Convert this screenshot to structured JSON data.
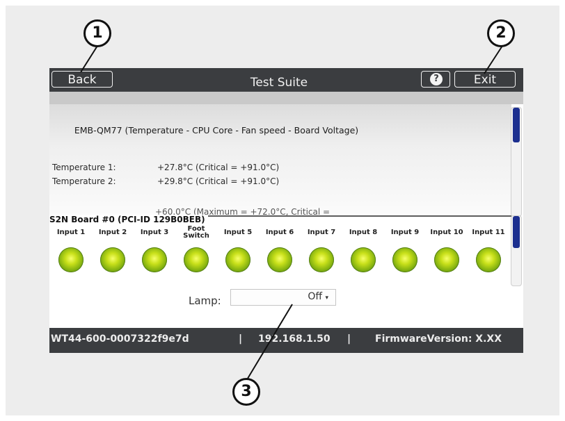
{
  "header": {
    "back_label": "Back",
    "title": "Test Suite",
    "help_label": "?",
    "exit_label": "Exit"
  },
  "sensors": {
    "title": "EMB-QM77 (Temperature - CPU Core - Fan speed - Board Voltage)",
    "rows": [
      {
        "label": "Temperature 1:",
        "value": "+27.8°C (Critical = +91.0°C)"
      },
      {
        "label": "Temperature 2:",
        "value": "+29.8°C (Critical = +91.0°C)"
      }
    ],
    "partial_line": "+60.0°C (Maximum = +72.0°C, Critical ="
  },
  "board": {
    "title": "S2N Board #0 (PCI-ID 129B0BEB)",
    "inputs": [
      {
        "label": "Input 1",
        "state": "on"
      },
      {
        "label": "Input 2",
        "state": "on"
      },
      {
        "label": "Input 3",
        "state": "on"
      },
      {
        "label": "Foot Switch",
        "state": "on"
      },
      {
        "label": "Input 5",
        "state": "on"
      },
      {
        "label": "Input 6",
        "state": "on"
      },
      {
        "label": "Input 7",
        "state": "on"
      },
      {
        "label": "Input 8",
        "state": "on"
      },
      {
        "label": "Input 9",
        "state": "on"
      },
      {
        "label": "Input 10",
        "state": "on"
      },
      {
        "label": "Input 11",
        "state": "on"
      }
    ]
  },
  "lamp": {
    "label": "Lamp:",
    "value": "Off"
  },
  "status": {
    "serial": "WT44-600-0007322f9e7d",
    "ip": "192.168.1.50",
    "firmware": "FirmwareVersion: X.XX"
  },
  "callouts": [
    "1",
    "2",
    "3"
  ],
  "colors": {
    "bar": "#3b3d40",
    "scroll_thumb": "#1c2f8f",
    "lamp_on": "#c8e01a"
  }
}
